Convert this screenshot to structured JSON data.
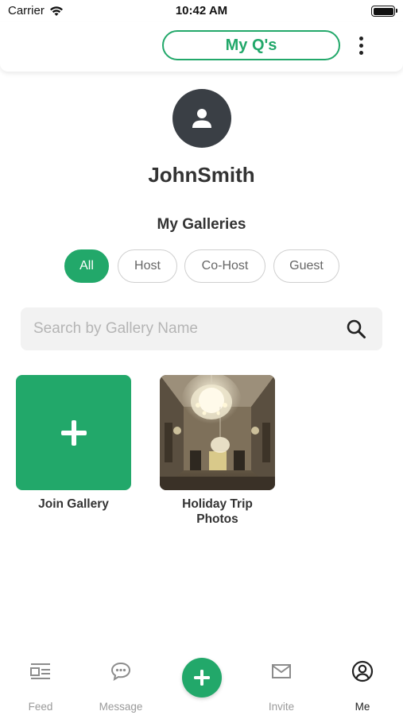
{
  "status_bar": {
    "carrier": "Carrier",
    "time": "10:42 AM",
    "battery_level": 1.0
  },
  "header": {
    "my_qs_label": "My Q's",
    "more_icon": "more-vertical-icon"
  },
  "profile": {
    "avatar_icon": "user-icon",
    "username": "JohnSmith"
  },
  "galleries": {
    "title": "My Galleries",
    "filters": [
      {
        "label": "All",
        "active": true
      },
      {
        "label": "Host",
        "active": false
      },
      {
        "label": "Co-Host",
        "active": false
      },
      {
        "label": "Guest",
        "active": false
      }
    ],
    "search_placeholder": "Search by Gallery Name",
    "search_value": "",
    "items": [
      {
        "label": "Join Gallery",
        "icon": "plus-icon"
      },
      {
        "label": "Holiday Trip Photos",
        "thumbnail": "chandelier-hall-photo"
      }
    ]
  },
  "tabbar": {
    "tabs": [
      {
        "label": "Feed",
        "icon": "feed-icon",
        "active": false
      },
      {
        "label": "Message",
        "icon": "chat-icon",
        "active": false
      },
      {
        "label": "Invite",
        "icon": "mail-icon",
        "active": false
      },
      {
        "label": "Me",
        "icon": "account-circle-icon",
        "active": true
      }
    ],
    "fab_icon": "plus-icon"
  },
  "colors": {
    "accent": "#22a86a",
    "avatar_bg": "#3a3f45",
    "text": "#333333",
    "muted": "#9a9a9a"
  }
}
